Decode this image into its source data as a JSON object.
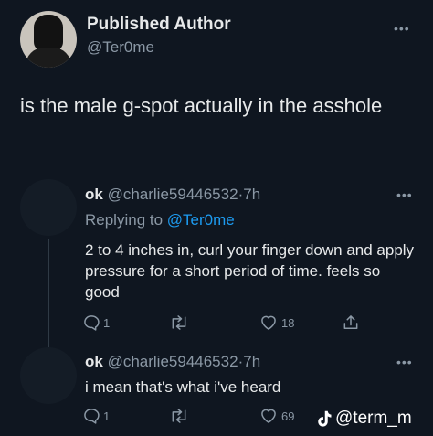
{
  "main_tweet": {
    "author_name": "Published Author",
    "author_handle": "@Ter0me",
    "text": "is the male g-spot actually in the asshole",
    "more_icon": "more-horizontal-icon"
  },
  "replies": [
    {
      "name": "ok",
      "handle": "@charlie59446532",
      "separator": "·",
      "time": "7h",
      "replying_to_label": "Replying to",
      "replying_to_handle": "@Ter0me",
      "text": "2 to 4 inches in, curl your finger down and apply pressure for a short period of time. feels so good",
      "reply_count": "1",
      "retweet_count": "",
      "like_count": "18"
    },
    {
      "name": "ok",
      "handle": "@charlie59446532",
      "separator": "·",
      "time": "7h",
      "text": "i mean that's what i've heard",
      "reply_count": "1",
      "retweet_count": "",
      "like_count": "69"
    }
  ],
  "watermark": {
    "text": "@term_m",
    "icon": "tiktok-icon"
  },
  "colors": {
    "background": "#0f1620",
    "text": "#e7e9ea",
    "secondary": "#8b98a5",
    "link": "#1d9bf0"
  }
}
